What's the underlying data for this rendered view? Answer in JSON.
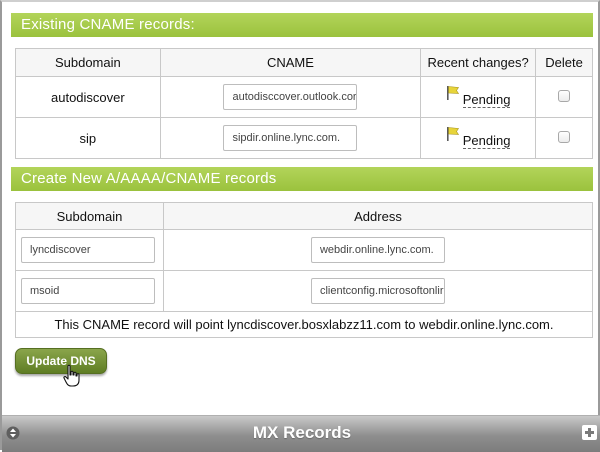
{
  "existing_section": {
    "title": "Existing CNAME records:",
    "columns": [
      "Subdomain",
      "CNAME",
      "Recent changes?",
      "Delete"
    ],
    "rows": [
      {
        "subdomain": "autodiscover",
        "cname": "autodisccover.outlook.cor",
        "status": "Pending",
        "delete_checked": false
      },
      {
        "subdomain": "sip",
        "cname": "sipdir.online.lync.com.",
        "status": "Pending",
        "delete_checked": false
      }
    ]
  },
  "create_section": {
    "title": "Create New A/AAAA/CNAME records",
    "columns": [
      "Subdomain",
      "Address"
    ],
    "rows": [
      {
        "subdomain": "lyncdiscover",
        "address": "webdir.online.lync.com."
      },
      {
        "subdomain": "msoid",
        "address": "clientconfig.microsoftonlir"
      }
    ],
    "note": "This CNAME record will point lyncdiscover.bosxlabzz11.com to webdir.online.lync.com."
  },
  "update_button": {
    "label": "Update DNS"
  },
  "mx_bar": {
    "title": "MX Records"
  },
  "colors": {
    "section_green": "#a4c948",
    "button_green": "#6f8c32",
    "bar_gray": "#8e8e8e",
    "flag_yellow": "#e7d43a"
  },
  "icons": {
    "flag": "flag-icon",
    "cursor": "hand-pointer-icon",
    "sort": "sort-arrows-icon",
    "add": "plus-icon"
  }
}
